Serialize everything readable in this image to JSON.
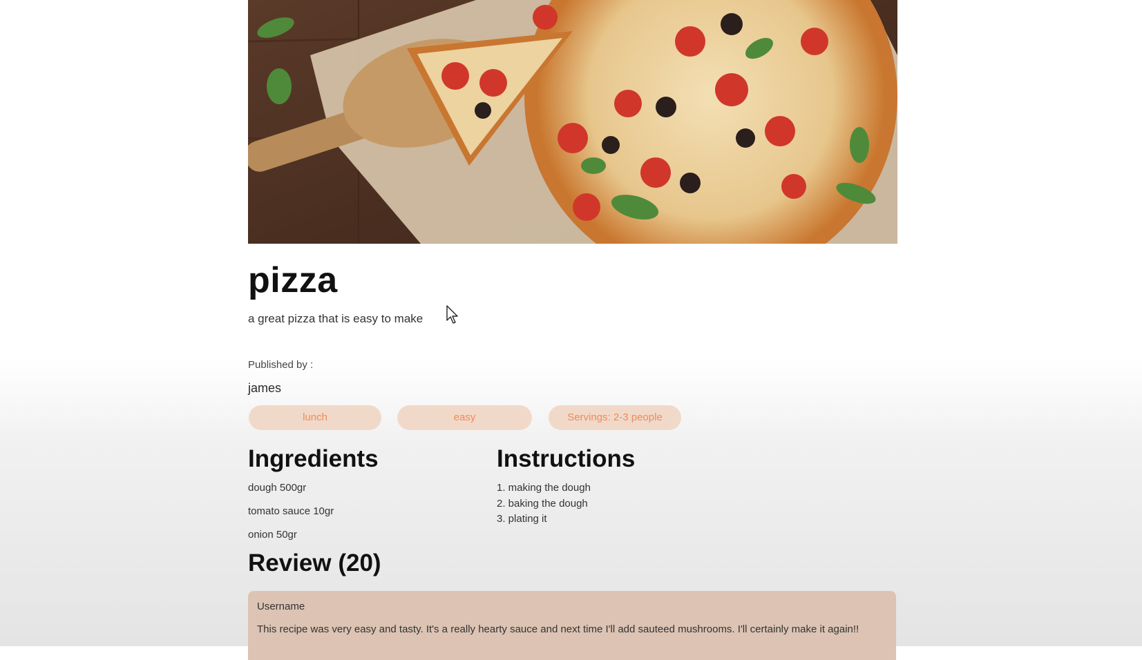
{
  "recipe": {
    "title": "pizza",
    "description": "a great pizza that is easy to make",
    "published_label": "Published by :",
    "author": "james",
    "hero_image_icon": "pizza-photo"
  },
  "tags": [
    {
      "label": "lunch"
    },
    {
      "label": "easy"
    },
    {
      "label": "Servings: 2-3 people"
    }
  ],
  "ingredients": {
    "title": "Ingredients",
    "items": [
      "dough 500gr",
      "tomato sauce 10gr",
      "onion 50gr"
    ]
  },
  "instructions": {
    "title": "Instructions",
    "items": [
      "1. making the dough",
      "2. baking the dough",
      "3. plating it"
    ]
  },
  "reviews": {
    "title": "Review (20)",
    "items": [
      {
        "username": "Username",
        "text": "This recipe was very easy and tasty. It's a really hearty sauce and next time I'll add sauteed mushrooms. I'll certainly make it again!!"
      }
    ]
  },
  "colors": {
    "tag_bg": "#f1d9ca",
    "tag_text": "#f08a55",
    "review_bg": "#dcc3b3"
  }
}
